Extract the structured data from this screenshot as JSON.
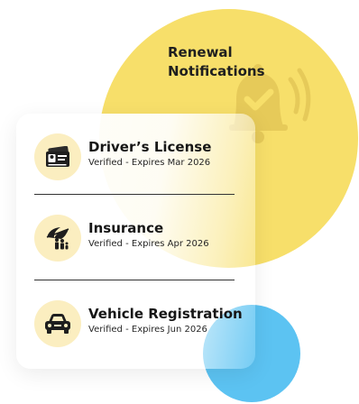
{
  "header": {
    "title_line1": "Renewal",
    "title_line2": "Notifications",
    "bell_icon": "bell-check-icon"
  },
  "colors": {
    "yellow_circle": "#f7df6a",
    "blue_circle": "#5cc3f2",
    "icon_bg": "#fbeec0"
  },
  "documents": [
    {
      "title": "Driver’s License",
      "status": "Verified - Expires Mar 2026",
      "icon": "id-card-icon"
    },
    {
      "title": "Insurance",
      "status": "Verified - Expires Apr 2026",
      "icon": "umbrella-family-icon"
    },
    {
      "title": "Vehicle Registration",
      "status": "Verified - Expires Jun 2026",
      "icon": "car-icon"
    }
  ]
}
